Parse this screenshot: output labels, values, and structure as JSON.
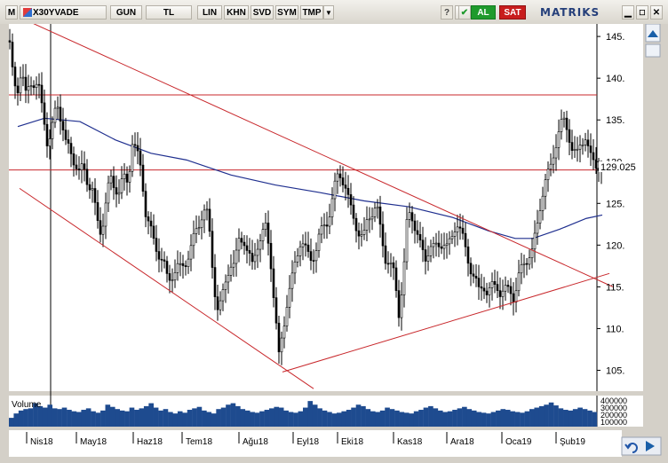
{
  "toolbar": {
    "m_label": "M",
    "symbol": "X30YVADE",
    "period": "GUN",
    "currency": "TL",
    "buttons": [
      "LIN",
      "KHN",
      "SVD",
      "SYM",
      "TMP"
    ],
    "al_label": "AL",
    "sat_label": "SAT",
    "logo": "MATRIKS",
    "window_buttons": [
      "minimize-icon",
      "maximize-icon",
      "close-icon"
    ],
    "colors": {
      "al": "#1f9a2c",
      "sat": "#c81d1d"
    }
  },
  "chart_data": {
    "type": "candlestick",
    "symbol": "X30YVADE",
    "ylim": [
      102.5,
      146.5
    ],
    "yticks": [
      145,
      140,
      135,
      130,
      125,
      120,
      115,
      110,
      105
    ],
    "ytick_labels": [
      "145.",
      "140.",
      "135.",
      "130.",
      "125.",
      "120.",
      "115.",
      "110.",
      "105."
    ],
    "last_price": 129.025,
    "last_price_label": "129.025",
    "months": [
      "Nis18",
      "May18",
      "Haz18",
      "Tem18",
      "Ağu18",
      "Eyl18",
      "Eki18",
      "Kas18",
      "Ara18",
      "Oca19",
      "Şub19"
    ],
    "volume_label": "Volume",
    "volume_axis_labels": [
      "400000",
      "300000",
      "200000",
      "100000"
    ],
    "horizontal_levels": [
      138.0,
      129.0
    ],
    "price_series": [
      [
        0,
        144.5
      ],
      [
        4,
        141
      ],
      [
        9,
        138.5
      ],
      [
        14,
        140.5
      ],
      [
        19,
        138
      ],
      [
        24,
        140
      ],
      [
        29,
        139
      ],
      [
        34,
        138.5
      ],
      [
        39,
        136
      ],
      [
        44,
        131.5
      ],
      [
        49,
        134
      ],
      [
        54,
        137.5
      ],
      [
        59,
        135
      ],
      [
        64,
        132
      ],
      [
        69,
        131.5
      ],
      [
        74,
        130
      ],
      [
        79,
        128.5
      ],
      [
        84,
        129.5
      ],
      [
        89,
        127.5
      ],
      [
        94,
        126.5
      ],
      [
        99,
        123
      ],
      [
        104,
        121.5
      ],
      [
        109,
        125
      ],
      [
        114,
        128
      ],
      [
        119,
        127
      ],
      [
        124,
        126.5
      ],
      [
        129,
        128
      ],
      [
        134,
        127.5
      ],
      [
        139,
        132.5
      ],
      [
        144,
        131
      ],
      [
        149,
        129
      ],
      [
        154,
        124
      ],
      [
        159,
        122
      ],
      [
        164,
        120
      ],
      [
        169,
        119
      ],
      [
        174,
        118
      ],
      [
        179,
        115.5
      ],
      [
        184,
        116.5
      ],
      [
        189,
        117.5
      ],
      [
        194,
        117
      ],
      [
        199,
        118
      ],
      [
        204,
        119.5
      ],
      [
        209,
        121
      ],
      [
        214,
        122.5
      ],
      [
        219,
        124.5
      ],
      [
        224,
        123.5
      ],
      [
        229,
        117.5
      ],
      [
        234,
        112.5
      ],
      [
        239,
        113
      ],
      [
        244,
        115.5
      ],
      [
        249,
        118
      ],
      [
        254,
        117.5
      ],
      [
        259,
        120.5
      ],
      [
        264,
        121
      ],
      [
        269,
        119
      ],
      [
        274,
        117.5
      ],
      [
        279,
        120
      ],
      [
        284,
        121
      ],
      [
        289,
        122
      ],
      [
        294,
        119
      ],
      [
        299,
        113
      ],
      [
        304,
        106.5
      ],
      [
        309,
        110
      ],
      [
        314,
        114
      ],
      [
        319,
        116
      ],
      [
        324,
        118.5
      ],
      [
        329,
        121
      ],
      [
        334,
        119.5
      ],
      [
        339,
        118
      ],
      [
        344,
        119
      ],
      [
        349,
        121
      ],
      [
        354,
        122
      ],
      [
        359,
        123
      ],
      [
        364,
        125.5
      ],
      [
        369,
        128
      ],
      [
        374,
        128.5
      ],
      [
        379,
        127
      ],
      [
        384,
        124.5
      ],
      [
        389,
        123
      ],
      [
        394,
        121.5
      ],
      [
        399,
        120.5
      ],
      [
        404,
        123.5
      ],
      [
        409,
        124
      ],
      [
        414,
        124.5
      ],
      [
        419,
        121.5
      ],
      [
        424,
        118.5
      ],
      [
        429,
        117.5
      ],
      [
        434,
        116.5
      ],
      [
        439,
        112
      ],
      [
        444,
        116
      ],
      [
        449,
        124
      ],
      [
        454,
        123.5
      ],
      [
        459,
        121.5
      ],
      [
        464,
        119.5
      ],
      [
        469,
        118.5
      ],
      [
        474,
        120
      ],
      [
        479,
        119.5
      ],
      [
        484,
        120
      ],
      [
        489,
        120.5
      ],
      [
        494,
        119.5
      ],
      [
        499,
        121
      ],
      [
        504,
        123
      ],
      [
        509,
        121.5
      ],
      [
        514,
        119.5
      ],
      [
        519,
        117.5
      ],
      [
        524,
        116
      ],
      [
        529,
        114.5
      ],
      [
        534,
        115.5
      ],
      [
        539,
        114
      ],
      [
        544,
        115
      ],
      [
        549,
        115.5
      ],
      [
        554,
        114
      ],
      [
        559,
        114.5
      ],
      [
        564,
        115
      ],
      [
        569,
        113.5
      ],
      [
        574,
        116
      ],
      [
        579,
        118
      ],
      [
        584,
        118.5
      ],
      [
        589,
        119
      ],
      [
        594,
        122
      ],
      [
        599,
        125.5
      ],
      [
        604,
        127.5
      ],
      [
        609,
        129
      ],
      [
        614,
        131.5
      ],
      [
        619,
        133.5
      ],
      [
        624,
        135
      ],
      [
        629,
        134
      ],
      [
        634,
        131.5
      ],
      [
        639,
        130.5
      ],
      [
        644,
        132.5
      ],
      [
        649,
        133
      ],
      [
        654,
        130.5
      ],
      [
        659,
        130
      ],
      [
        664,
        129.5
      ],
      [
        668,
        129.025
      ]
    ],
    "moving_average": [
      [
        10,
        134.2
      ],
      [
        40,
        135.2
      ],
      [
        80,
        134.8
      ],
      [
        120,
        132.6
      ],
      [
        160,
        131
      ],
      [
        200,
        130.2
      ],
      [
        250,
        128.4
      ],
      [
        300,
        127.2
      ],
      [
        350,
        126.3
      ],
      [
        400,
        125.3
      ],
      [
        450,
        124.6
      ],
      [
        500,
        123.3
      ],
      [
        540,
        121.7
      ],
      [
        570,
        120.8
      ],
      [
        590,
        120.8
      ],
      [
        620,
        121.9
      ],
      [
        650,
        123.2
      ],
      [
        668,
        123.6
      ]
    ],
    "trendlines": [
      {
        "name": "upper-descending",
        "from": [
          12,
          147.3
        ],
        "to": [
          680,
          115
        ]
      },
      {
        "name": "lower-descending",
        "from": [
          12,
          126.8
        ],
        "to": [
          343,
          102.8
        ]
      },
      {
        "name": "lower-ascending",
        "from": [
          308,
          104.8
        ],
        "to": [
          676,
          116.6
        ]
      }
    ],
    "volume": [
      120000,
      180000,
      220000,
      240000,
      250000,
      320000,
      280000,
      260000,
      300000,
      250000,
      240000,
      260000,
      230000,
      210000,
      200000,
      230000,
      250000,
      210000,
      190000,
      220000,
      300000,
      270000,
      240000,
      220000,
      210000,
      260000,
      230000,
      250000,
      280000,
      320000,
      260000,
      220000,
      240000,
      200000,
      180000,
      210000,
      190000,
      230000,
      250000,
      270000,
      220000,
      200000,
      180000,
      240000,
      260000,
      300000,
      320000,
      280000,
      240000,
      220000,
      200000,
      190000,
      210000,
      230000,
      250000,
      270000,
      260000,
      220000,
      200000,
      190000,
      210000,
      260000,
      350000,
      300000,
      250000,
      220000,
      200000,
      180000,
      190000,
      210000,
      230000,
      260000,
      300000,
      280000,
      240000,
      210000,
      200000,
      220000,
      260000,
      240000,
      220000,
      200000,
      190000,
      180000,
      210000,
      230000,
      260000,
      280000,
      250000,
      220000,
      200000,
      210000,
      230000,
      250000,
      270000,
      240000,
      220000,
      200000,
      190000,
      180000,
      200000,
      220000,
      240000,
      230000,
      210000,
      200000,
      190000,
      210000,
      240000,
      260000,
      280000,
      300000,
      330000,
      290000,
      250000,
      230000,
      220000,
      240000,
      260000,
      240000,
      220000,
      200000
    ]
  }
}
